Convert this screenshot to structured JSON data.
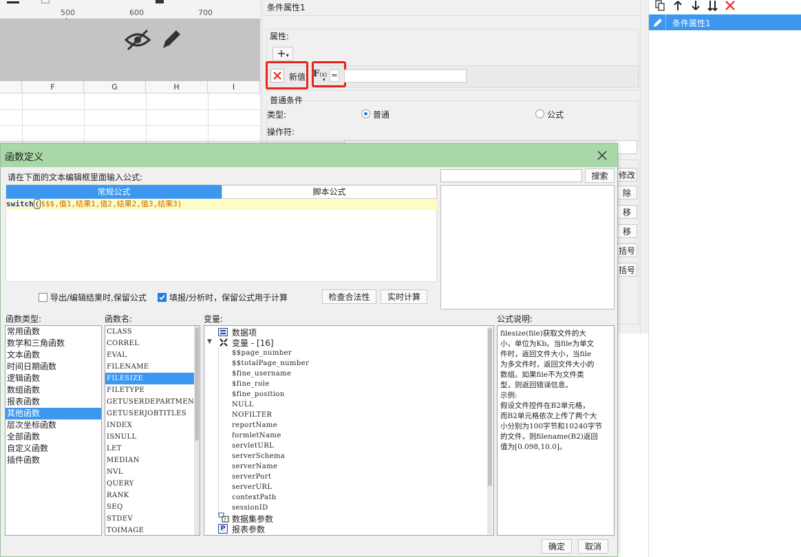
{
  "ruler": {
    "ticks": [
      "500",
      "600",
      "700"
    ]
  },
  "grid": {
    "columns": [
      "F",
      "G",
      "H",
      "I"
    ]
  },
  "condition_panel": {
    "title": "条件属性1",
    "attribute_label": "属性:",
    "add_symbol": "+",
    "new_value_label": "新值",
    "fx_label": "F",
    "equals": "=",
    "common_condition_label": "普通条件",
    "type_label": "类型:",
    "radio_common": "普通",
    "radio_formula": "公式",
    "operator_label": "操作符:",
    "side_buttons": [
      "修改",
      "除",
      "移",
      "移",
      "括号",
      "括号"
    ]
  },
  "side_panel": {
    "item": "条件属性1"
  },
  "dialog": {
    "title": "函数定义",
    "prompt": "请在下面的文本编辑框里面输入公式:",
    "tabs": [
      "常规公式",
      "脚本公式"
    ],
    "formula": {
      "fn": "switch",
      "open": "(",
      "args": "$$$,值1,结果1,值2,结果2,值3,结果3",
      "close": ")"
    },
    "search_button": "搜索",
    "search_value": "",
    "checkbox_export": "导出/编辑结果时,保留公式",
    "checkbox_fill": "填报/分析时，保留公式用于计算",
    "check_button": "检查合法性",
    "realtime_button": "实时计算",
    "function_type_label": "函数类型:",
    "function_types": [
      "常用函数",
      "数学和三角函数",
      "文本函数",
      "时间日期函数",
      "逻辑函数",
      "数组函数",
      "报表函数",
      "其他函数",
      "层次坐标函数",
      "全部函数",
      "自定义函数",
      "插件函数"
    ],
    "function_type_selected": "其他函数",
    "function_name_label": "函数名:",
    "function_names": [
      "CLASS",
      "CORREL",
      "EVAL",
      "FILENAME",
      "FILESIZE",
      "FILETYPE",
      "GETUSERDEPARTMENTS",
      "GETUSERJOBTITLES",
      "INDEX",
      "ISNULL",
      "LET",
      "MEDIAN",
      "NVL",
      "QUERY",
      "RANK",
      "SEQ",
      "STDEV",
      "TOIMAGE"
    ],
    "function_name_selected": "FILESIZE",
    "variable_label": "变量:",
    "variables": {
      "data_items": "数据项",
      "variable_group": "变量 - [16]",
      "variable_items": [
        "$$page_number",
        "$$totalPage_number",
        "$fine_username",
        "$fine_role",
        "$fine_position",
        "NULL",
        "NOFILTER",
        "reportName",
        "formletName",
        "servletURL",
        "serverSchema",
        "serverName",
        "serverPort",
        "serverURL",
        "contextPath",
        "sessionID"
      ],
      "dataset_params": "数据集参数",
      "report_params": "报表参数"
    },
    "description_label": "公式说明:",
    "description_lines": [
      "filesize(file)获取文件的大",
      "小，单位为Kb。当file为单文",
      "件时，返回文件大小，当file",
      "为多文件时，返回文件大小的",
      "数组。如果file不为文件类",
      "型，则返回错误信息。",
      "示例:",
      "假设文件控件在B2单元格，",
      "而B2单元格依次上传了两个大",
      "小分别为100字节和10240字节",
      "的文件，则filename(B2)返回",
      "值为[0.098,10.0]。"
    ],
    "ok_button": "确定",
    "cancel_button": "取消"
  },
  "colors": {
    "accent": "#3b97f0",
    "dialog_title_bg": "#a8d7a8",
    "highlight_box": "#e8231c",
    "formula_bg": "#fffbc4"
  }
}
